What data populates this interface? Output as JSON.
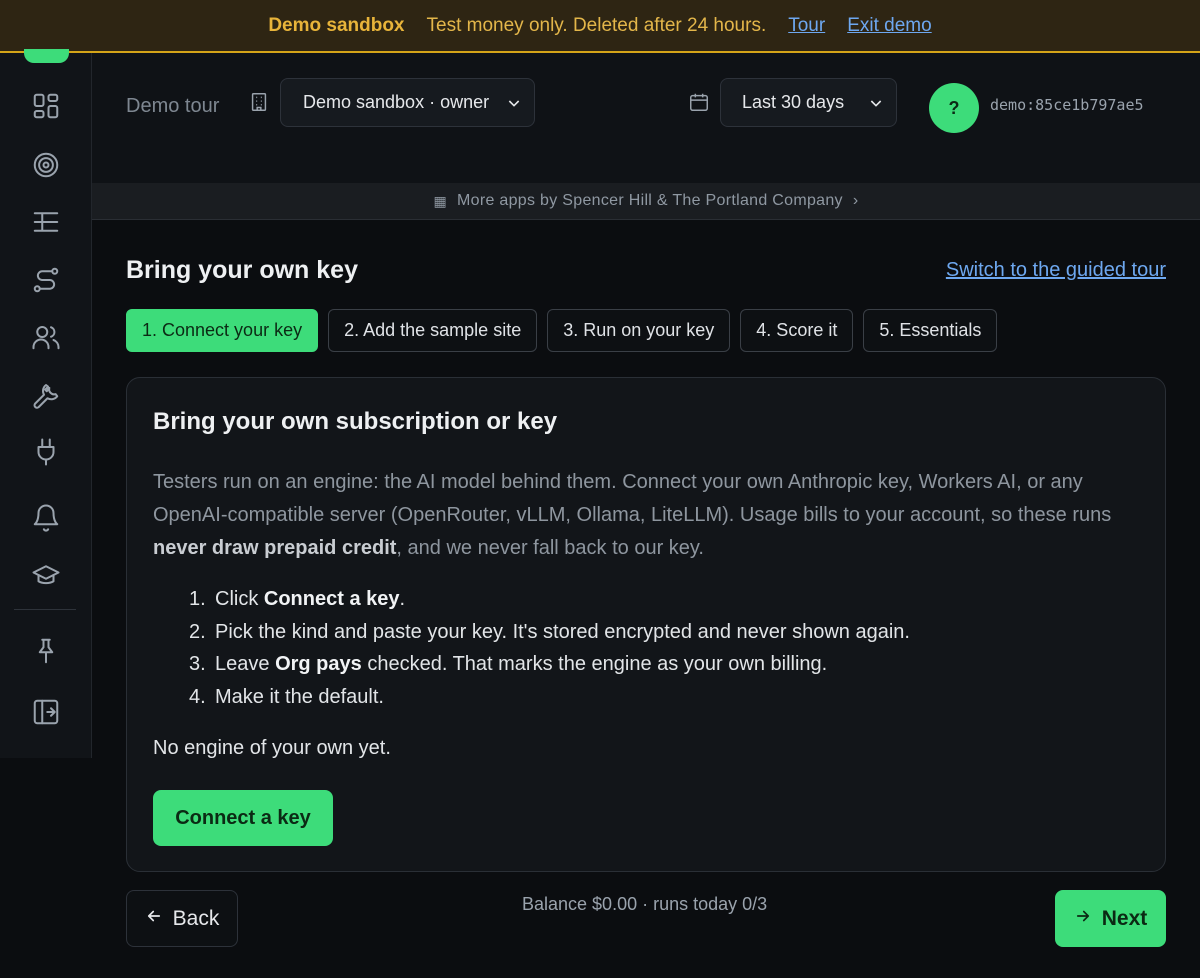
{
  "banner": {
    "title": "Demo sandbox",
    "text": "Test money only. Deleted after 24 hours.",
    "tour_link": "Tour",
    "exit_link": "Exit demo",
    "accent_color": "#d4a418"
  },
  "sidebar": {
    "items": [
      {
        "icon": "dashboard-icon"
      },
      {
        "icon": "target-icon"
      },
      {
        "icon": "list-tree-icon"
      },
      {
        "icon": "route-icon"
      },
      {
        "icon": "users-icon"
      },
      {
        "icon": "wrench-icon"
      },
      {
        "icon": "plug-icon"
      },
      {
        "icon": "bell-icon"
      },
      {
        "icon": "graduation-cap-icon"
      },
      {
        "icon": "pin-icon"
      },
      {
        "icon": "sign-out-icon"
      }
    ]
  },
  "topbar": {
    "breadcrumb": "Demo tour",
    "org_select": "Demo sandbox · owner",
    "date_select": "Last 30 days",
    "avatar_initial": "?",
    "user_id": "demo:85ce1b797ae5"
  },
  "apps_strip": {
    "label": "More apps by Spencer Hill & The Portland Company",
    "chevron": "›"
  },
  "main": {
    "title": "Bring your own key",
    "guided_link": "Switch to the guided tour",
    "steps": [
      "1. Connect your key",
      "2. Add the sample site",
      "3. Run on your key",
      "4. Score it",
      "5. Essentials"
    ],
    "active_step": 0
  },
  "card": {
    "title": "Bring your own subscription or key",
    "desc_1": "Testers run on an engine: the AI model behind them. Connect your own Anthropic key, Workers AI, or any OpenAI-compatible server (OpenRouter, vLLM, Ollama, LiteLLM). Usage bills to your account, so these runs ",
    "desc_bold": "never draw prepaid credit",
    "desc_2": ", and we never fall back to our key.",
    "list": [
      {
        "num": "1.",
        "pre": "Click ",
        "bold": "Connect a key",
        "post": "."
      },
      {
        "num": "2.",
        "pre": "Pick the kind and paste your key. It's stored encrypted and never shown again.",
        "bold": "",
        "post": ""
      },
      {
        "num": "3.",
        "pre": "Leave ",
        "bold": "Org pays",
        "post": " checked. That marks the engine as your own billing."
      },
      {
        "num": "4.",
        "pre": "Make it the default.",
        "bold": "",
        "post": ""
      }
    ],
    "empty_state": "No engine of your own yet.",
    "connect_button": "Connect a key"
  },
  "footer": {
    "back_label": "Back",
    "balance": "Balance $0.00 · runs today 0/3",
    "next_label": "Next"
  },
  "colors": {
    "brand_green": "#3ddc7a",
    "link_blue": "#6ea8f0",
    "background": "#0b0d10"
  }
}
